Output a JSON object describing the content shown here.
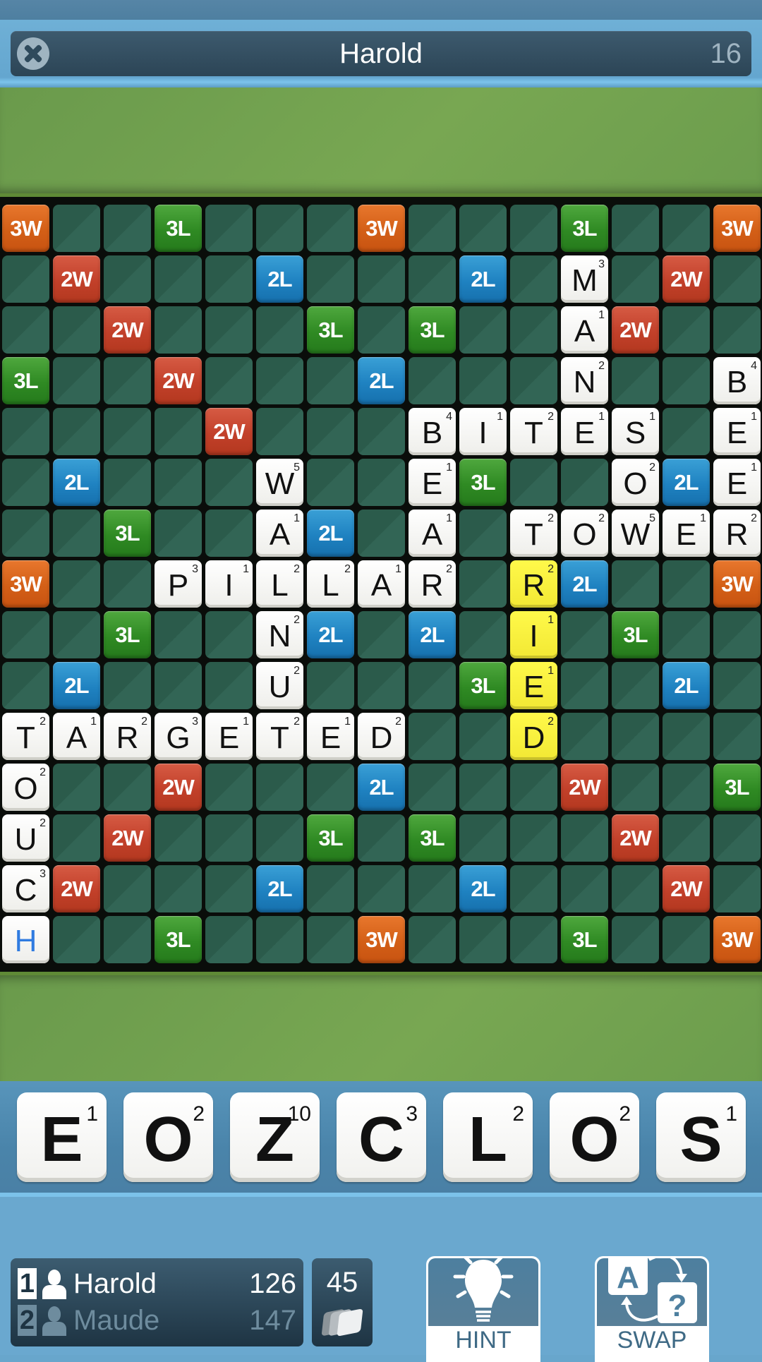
{
  "header": {
    "title": "Harold",
    "turn_counter": "16",
    "close_icon": "close-circle-icon"
  },
  "board": {
    "size": 15,
    "cells": [
      {
        "r": 0,
        "c": 0,
        "bonus": "3W"
      },
      {
        "r": 0,
        "c": 3,
        "bonus": "3L"
      },
      {
        "r": 0,
        "c": 7,
        "bonus": "3W"
      },
      {
        "r": 0,
        "c": 11,
        "bonus": "3L"
      },
      {
        "r": 0,
        "c": 14,
        "bonus": "3W"
      },
      {
        "r": 1,
        "c": 1,
        "bonus": "2W"
      },
      {
        "r": 1,
        "c": 5,
        "bonus": "2L"
      },
      {
        "r": 1,
        "c": 9,
        "bonus": "2L"
      },
      {
        "r": 1,
        "c": 11,
        "letter": "M",
        "points": "3"
      },
      {
        "r": 1,
        "c": 13,
        "bonus": "2W"
      },
      {
        "r": 2,
        "c": 2,
        "bonus": "2W"
      },
      {
        "r": 2,
        "c": 6,
        "bonus": "3L"
      },
      {
        "r": 2,
        "c": 8,
        "bonus": "3L"
      },
      {
        "r": 2,
        "c": 11,
        "letter": "A",
        "points": "1"
      },
      {
        "r": 2,
        "c": 12,
        "bonus": "2W"
      },
      {
        "r": 3,
        "c": 0,
        "bonus": "3L"
      },
      {
        "r": 3,
        "c": 3,
        "bonus": "2W"
      },
      {
        "r": 3,
        "c": 7,
        "bonus": "2L"
      },
      {
        "r": 3,
        "c": 11,
        "letter": "N",
        "points": "2"
      },
      {
        "r": 3,
        "c": 14,
        "letter": "B",
        "points": "4"
      },
      {
        "r": 4,
        "c": 4,
        "bonus": "2W"
      },
      {
        "r": 4,
        "c": 8,
        "letter": "B",
        "points": "4"
      },
      {
        "r": 4,
        "c": 9,
        "letter": "I",
        "points": "1"
      },
      {
        "r": 4,
        "c": 10,
        "letter": "T",
        "points": "2"
      },
      {
        "r": 4,
        "c": 11,
        "letter": "E",
        "points": "1"
      },
      {
        "r": 4,
        "c": 12,
        "letter": "S",
        "points": "1"
      },
      {
        "r": 4,
        "c": 14,
        "letter": "E",
        "points": "1"
      },
      {
        "r": 5,
        "c": 1,
        "bonus": "2L"
      },
      {
        "r": 5,
        "c": 5,
        "letter": "W",
        "points": "5"
      },
      {
        "r": 5,
        "c": 8,
        "letter": "E",
        "points": "1"
      },
      {
        "r": 5,
        "c": 9,
        "bonus": "3L"
      },
      {
        "r": 5,
        "c": 12,
        "letter": "O",
        "points": "2"
      },
      {
        "r": 5,
        "c": 13,
        "bonus": "2L"
      },
      {
        "r": 5,
        "c": 14,
        "letter": "E",
        "points": "1"
      },
      {
        "r": 6,
        "c": 2,
        "bonus": "3L"
      },
      {
        "r": 6,
        "c": 5,
        "letter": "A",
        "points": "1"
      },
      {
        "r": 6,
        "c": 6,
        "bonus": "2L"
      },
      {
        "r": 6,
        "c": 8,
        "letter": "A",
        "points": "1"
      },
      {
        "r": 6,
        "c": 10,
        "letter": "T",
        "points": "2"
      },
      {
        "r": 6,
        "c": 11,
        "letter": "O",
        "points": "2"
      },
      {
        "r": 6,
        "c": 12,
        "letter": "W",
        "points": "5"
      },
      {
        "r": 6,
        "c": 13,
        "letter": "E",
        "points": "1"
      },
      {
        "r": 6,
        "c": 14,
        "letter": "R",
        "points": "2"
      },
      {
        "r": 7,
        "c": 0,
        "bonus": "3W"
      },
      {
        "r": 7,
        "c": 3,
        "letter": "P",
        "points": "3"
      },
      {
        "r": 7,
        "c": 4,
        "letter": "I",
        "points": "1"
      },
      {
        "r": 7,
        "c": 5,
        "letter": "L",
        "points": "2"
      },
      {
        "r": 7,
        "c": 6,
        "letter": "L",
        "points": "2"
      },
      {
        "r": 7,
        "c": 7,
        "letter": "A",
        "points": "1"
      },
      {
        "r": 7,
        "c": 8,
        "letter": "R",
        "points": "2"
      },
      {
        "r": 7,
        "c": 10,
        "letter": "R",
        "points": "2",
        "highlight": "yellow"
      },
      {
        "r": 7,
        "c": 11,
        "bonus": "2L"
      },
      {
        "r": 7,
        "c": 14,
        "bonus": "3W"
      },
      {
        "r": 8,
        "c": 2,
        "bonus": "3L"
      },
      {
        "r": 8,
        "c": 5,
        "letter": "N",
        "points": "2"
      },
      {
        "r": 8,
        "c": 6,
        "bonus": "2L"
      },
      {
        "r": 8,
        "c": 8,
        "bonus": "2L"
      },
      {
        "r": 8,
        "c": 10,
        "letter": "I",
        "points": "1",
        "highlight": "yellow"
      },
      {
        "r": 8,
        "c": 12,
        "bonus": "3L"
      },
      {
        "r": 9,
        "c": 1,
        "bonus": "2L"
      },
      {
        "r": 9,
        "c": 5,
        "letter": "U",
        "points": "2"
      },
      {
        "r": 9,
        "c": 9,
        "bonus": "3L"
      },
      {
        "r": 9,
        "c": 10,
        "letter": "E",
        "points": "1",
        "highlight": "yellow"
      },
      {
        "r": 9,
        "c": 13,
        "bonus": "2L"
      },
      {
        "r": 10,
        "c": 0,
        "letter": "T",
        "points": "2"
      },
      {
        "r": 10,
        "c": 1,
        "letter": "A",
        "points": "1"
      },
      {
        "r": 10,
        "c": 2,
        "letter": "R",
        "points": "2"
      },
      {
        "r": 10,
        "c": 3,
        "letter": "G",
        "points": "3"
      },
      {
        "r": 10,
        "c": 4,
        "letter": "E",
        "points": "1"
      },
      {
        "r": 10,
        "c": 5,
        "letter": "T",
        "points": "2"
      },
      {
        "r": 10,
        "c": 6,
        "letter": "E",
        "points": "1"
      },
      {
        "r": 10,
        "c": 7,
        "letter": "D",
        "points": "2"
      },
      {
        "r": 10,
        "c": 10,
        "letter": "D",
        "points": "2",
        "highlight": "yellow"
      },
      {
        "r": 11,
        "c": 0,
        "letter": "O",
        "points": "2"
      },
      {
        "r": 11,
        "c": 3,
        "bonus": "2W"
      },
      {
        "r": 11,
        "c": 7,
        "bonus": "2L"
      },
      {
        "r": 11,
        "c": 11,
        "bonus": "2W"
      },
      {
        "r": 11,
        "c": 14,
        "bonus": "3L"
      },
      {
        "r": 12,
        "c": 0,
        "letter": "U",
        "points": "2"
      },
      {
        "r": 12,
        "c": 2,
        "bonus": "2W"
      },
      {
        "r": 12,
        "c": 6,
        "bonus": "3L"
      },
      {
        "r": 12,
        "c": 8,
        "bonus": "3L"
      },
      {
        "r": 12,
        "c": 12,
        "bonus": "2W"
      },
      {
        "r": 13,
        "c": 0,
        "letter": "C",
        "points": "3"
      },
      {
        "r": 13,
        "c": 1,
        "bonus": "2W"
      },
      {
        "r": 13,
        "c": 5,
        "bonus": "2L"
      },
      {
        "r": 13,
        "c": 9,
        "bonus": "2L"
      },
      {
        "r": 13,
        "c": 13,
        "bonus": "2W"
      },
      {
        "r": 14,
        "c": 0,
        "letter": "H",
        "points": "",
        "blank": true
      },
      {
        "r": 14,
        "c": 3,
        "bonus": "3L"
      },
      {
        "r": 14,
        "c": 7,
        "bonus": "3W"
      },
      {
        "r": 14,
        "c": 11,
        "bonus": "3L"
      },
      {
        "r": 14,
        "c": 14,
        "bonus": "3W"
      }
    ]
  },
  "rack": [
    {
      "letter": "E",
      "points": "1"
    },
    {
      "letter": "O",
      "points": "2"
    },
    {
      "letter": "Z",
      "points": "10"
    },
    {
      "letter": "C",
      "points": "3"
    },
    {
      "letter": "L",
      "points": "2"
    },
    {
      "letter": "O",
      "points": "2"
    },
    {
      "letter": "S",
      "points": "1"
    }
  ],
  "scoreboard": {
    "players": [
      {
        "rank": "1",
        "name": "Harold",
        "score": "126",
        "active": true
      },
      {
        "rank": "2",
        "name": "Maude",
        "score": "147",
        "active": false
      }
    ],
    "tiles_remaining": "45"
  },
  "actions": {
    "hint_label": "HINT",
    "swap_label": "SWAP",
    "swap_tile_letter": "A",
    "swap_tile_unknown": "?"
  }
}
